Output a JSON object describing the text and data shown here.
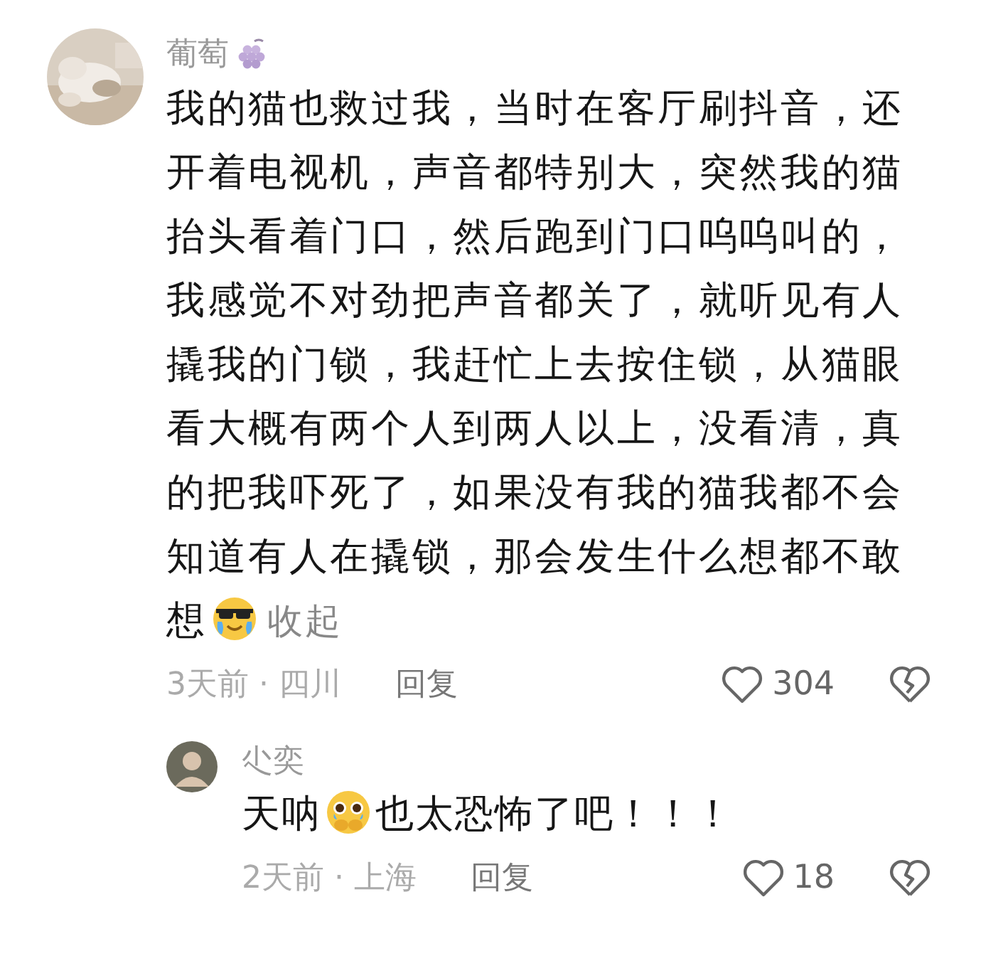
{
  "comments": [
    {
      "author": "葡萄",
      "badge": true,
      "content": [
        {
          "kind": "text",
          "text": "我的猫也救过我，当时在客厅刷抖音，还开着电视机，声音都特别大，突然我的猫抬头看着门口，然后跑到门口呜呜叫的，我感觉不对劲把声音都关了，就听见有人撬我的门锁，我赶忙上去按住锁，从猫眼看大概有两个人到两人以上，没看清，真的把我吓死了，如果没有我的猫我都不会知道有人在撬锁，那会发生什么想都不敢"
        },
        {
          "kind": "text",
          "text": "想"
        },
        {
          "kind": "emoji_sunglasses_tears"
        }
      ],
      "collapse": "收起",
      "time_location": "3天前 · 四川",
      "reply": "回复",
      "likes": "304",
      "replies": [
        {
          "author": "尐奕",
          "content": [
            {
              "kind": "text",
              "text": "天呐"
            },
            {
              "kind": "emoji_pleading"
            },
            {
              "kind": "text",
              "text": "也太恐怖了吧！！！"
            }
          ],
          "time_location": "2天前 · 上海",
          "reply": "回复",
          "likes": "18"
        }
      ]
    }
  ]
}
